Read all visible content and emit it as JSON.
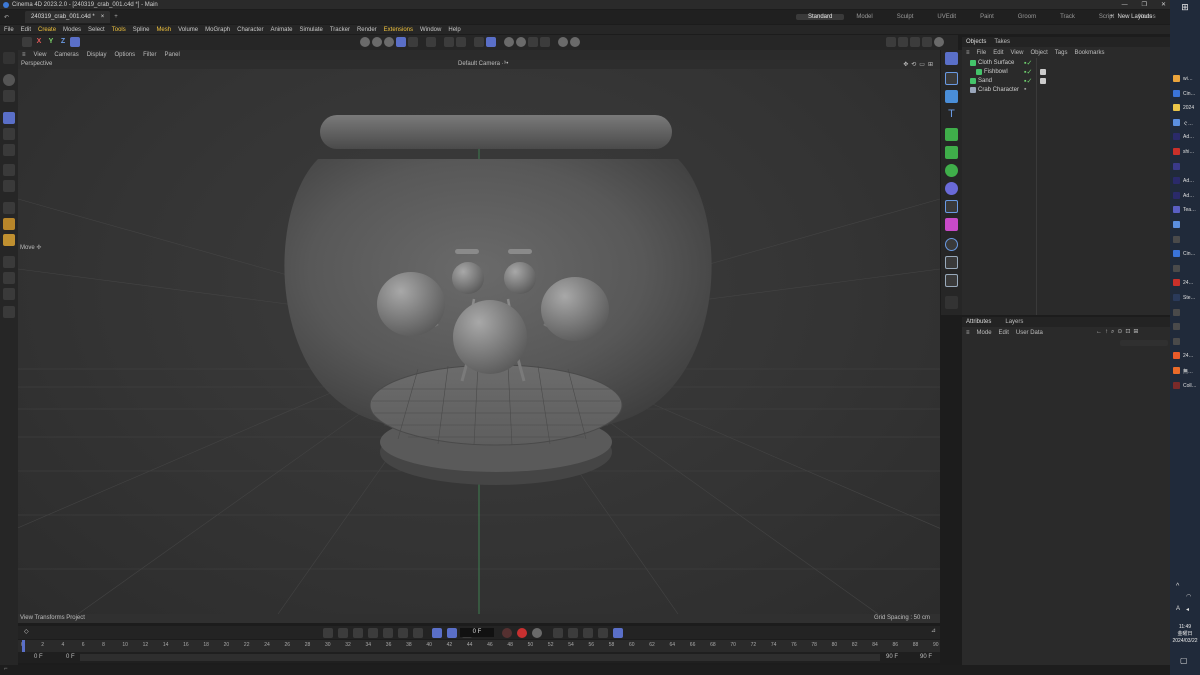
{
  "window": {
    "title": "Cinema 4D 2023.2.0 - [240319_crab_001.c4d *] - Main",
    "doc_tab": "240319_crab_001.c4d *"
  },
  "layouts": {
    "items": [
      "Standard",
      "Model",
      "Sculpt",
      "UVEdit",
      "Paint",
      "Groom",
      "Track",
      "Script",
      "Nodes"
    ],
    "active": "Standard",
    "new_layouts": "New Layouts"
  },
  "menu": {
    "items": [
      "File",
      "Edit",
      "Create",
      "Modes",
      "Select",
      "Tools",
      "Spline",
      "Mesh",
      "Volume",
      "MoGraph",
      "Character",
      "Animate",
      "Simulate",
      "Tracker",
      "Render",
      "Extensions",
      "Window",
      "Help"
    ],
    "highlighted": [
      "Create",
      "Tools",
      "Mesh",
      "Extensions"
    ]
  },
  "toolbar": {
    "axes": [
      "X",
      "Y",
      "Z"
    ]
  },
  "viewport": {
    "menu": [
      "View",
      "Cameras",
      "Display",
      "Options",
      "Filter",
      "Panel"
    ],
    "name": "Perspective",
    "camera": "Default Camera ·⁹•",
    "tool_label": "Move ✢",
    "footer_left": "View Transforms Project",
    "grid_spacing": "Grid Spacing : 50 cm"
  },
  "objects_panel": {
    "tabs": [
      "Objects",
      "Takes"
    ],
    "menu": [
      "File",
      "Edit",
      "View",
      "Object",
      "Tags",
      "Bookmarks"
    ],
    "items": [
      {
        "name": "Cloth Surface",
        "color": "#44c46a"
      },
      {
        "name": "Fishbowl",
        "color": "#44c46a"
      },
      {
        "name": "Sand",
        "color": "#44c46a"
      },
      {
        "name": "Crab Character",
        "color": "#9aa6bb"
      }
    ]
  },
  "attributes_panel": {
    "tabs": [
      "Attributes",
      "Layers"
    ],
    "menu": [
      "Mode",
      "Edit",
      "User Data"
    ]
  },
  "timeline": {
    "current_frame": "0 F",
    "ruler": [
      "0",
      "2",
      "4",
      "6",
      "8",
      "10",
      "12",
      "14",
      "16",
      "18",
      "20",
      "22",
      "24",
      "26",
      "28",
      "30",
      "32",
      "34",
      "36",
      "38",
      "40",
      "42",
      "44",
      "46",
      "48",
      "50",
      "52",
      "54",
      "56",
      "58",
      "60",
      "62",
      "64",
      "66",
      "68",
      "70",
      "72",
      "74",
      "76",
      "78",
      "80",
      "82",
      "84",
      "86",
      "88",
      "90"
    ],
    "start_a": "0 F",
    "start_b": "0 F",
    "end_a": "90 F",
    "end_b": "90 F"
  },
  "taskbar": {
    "items": [
      {
        "label": "wi…",
        "color": "#e8a33d"
      },
      {
        "label": "Cin…",
        "color": "#3a73d9"
      },
      {
        "label": "2024",
        "color": "#e8c44a"
      },
      {
        "label": "ぐ…",
        "color": "#5b8fe0"
      },
      {
        "label": "Ad…",
        "color": "#2a2a6a"
      },
      {
        "label": "shi…",
        "color": "#c8302a"
      },
      {
        "label": "",
        "color": "#3a3a8a"
      },
      {
        "label": "Ad…",
        "color": "#2a2a6a"
      },
      {
        "label": "Ad…",
        "color": "#2a2a6a"
      },
      {
        "label": "Tea…",
        "color": "#5a5fc4"
      },
      {
        "label": "",
        "color": "#5b8fe0"
      },
      {
        "label": "",
        "color": "#4a4a4a"
      },
      {
        "label": "Cin…",
        "color": "#3a73d9"
      },
      {
        "label": "",
        "color": "#4a4a4a"
      },
      {
        "label": "24…",
        "color": "#c8302a"
      },
      {
        "label": "Ste…",
        "color": "#2a3a5a"
      },
      {
        "label": "",
        "color": "#4a4a4a"
      },
      {
        "label": "",
        "color": "#4a4a4a"
      },
      {
        "label": "",
        "color": "#4a4a4a"
      },
      {
        "label": "24…",
        "color": "#e85a2a"
      },
      {
        "label": "無…",
        "color": "#e86a2a"
      },
      {
        "label": "Coll…",
        "color": "#7a2a2a"
      }
    ],
    "clock_time": "11:49",
    "clock_day": "金曜日",
    "clock_date": "2024/03/22",
    "ime": "A"
  }
}
